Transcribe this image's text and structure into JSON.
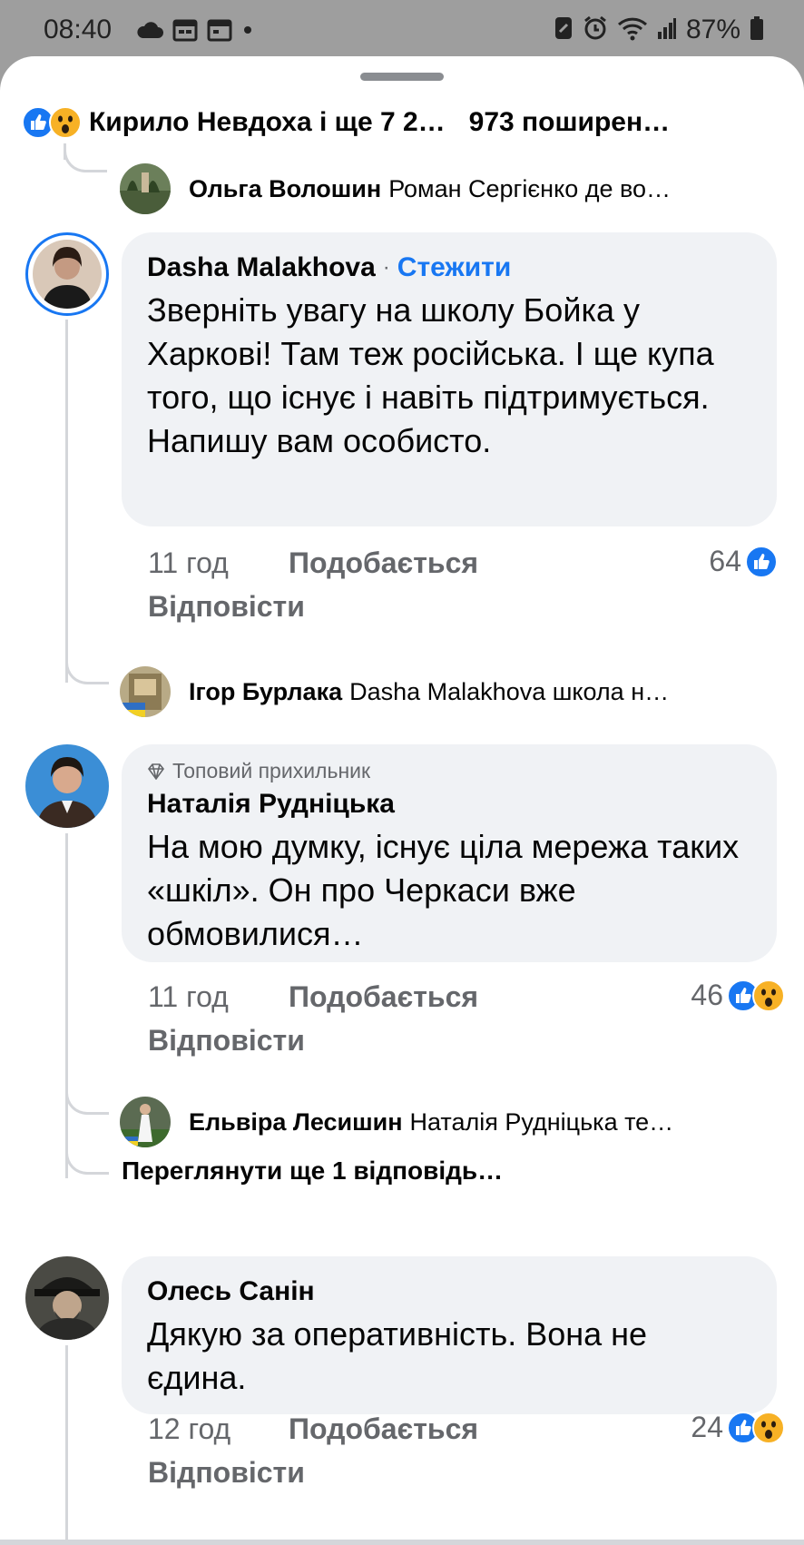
{
  "status_bar": {
    "time": "08:40",
    "battery": "87%",
    "icons_left": [
      "cloud-icon",
      "calendar-icon",
      "calendar-icon",
      "dot-icon"
    ],
    "icons_right": [
      "nfc-icon",
      "alarm-icon",
      "wifi-icon",
      "signal-icon",
      "battery-icon"
    ]
  },
  "reactions_bar": {
    "names": "Кирило Невдоха і ще 7 2…",
    "shares": "973 поширен…",
    "icons": [
      "like-reaction-icon",
      "wow-reaction-icon"
    ]
  },
  "comments": [
    {
      "type": "reply_preview",
      "name": "Ольга Волошин",
      "text": "Роман Сергієнко де во…"
    },
    {
      "type": "comment",
      "author": "Dasha Malakhova",
      "dot": "·",
      "follow": "Стежити",
      "text": "Зверніть увагу на школу Бойка у Харкові! Там теж російська. І ще купа того, що існує і навіть підтримується. Напишу вам особисто.",
      "time": "11 год",
      "like_label": "Подобається",
      "reply_label": "Відповісти",
      "count": "64",
      "reactions": [
        "like-reaction-icon"
      ]
    },
    {
      "type": "reply_preview",
      "name": "Ігор Бурлака",
      "text": "Dasha Malakhova школа н…"
    },
    {
      "type": "comment",
      "badge": "Топовий прихильник",
      "author": "Наталія Рудніцька",
      "text": "На мою думку, існує ціла мережа таких «шкіл». Он про Черкаси вже обмовилися…",
      "time": "11 год",
      "like_label": "Подобається",
      "reply_label": "Відповісти",
      "count": "46",
      "reactions": [
        "like-reaction-icon",
        "wow-reaction-icon"
      ]
    },
    {
      "type": "reply_preview",
      "name": "Ельвіра Лесишин",
      "text": "Наталія Рудніцька  те…"
    },
    {
      "type": "more",
      "text": "Переглянути ще 1 відповідь…"
    },
    {
      "type": "comment",
      "author": "Олесь Санін",
      "text": "Дякую за оперативність.  Вона не єдина.",
      "time": "12 год",
      "like_label": "Подобається",
      "reply_label": "Відповісти",
      "count": "24",
      "reactions": [
        "like-reaction-icon",
        "wow-reaction-icon"
      ]
    }
  ],
  "colors": {
    "accent": "#1877f2",
    "bubble": "#f0f2f5",
    "secondary_text": "#65676b",
    "status_bar_bg": "#9e9e9e"
  }
}
